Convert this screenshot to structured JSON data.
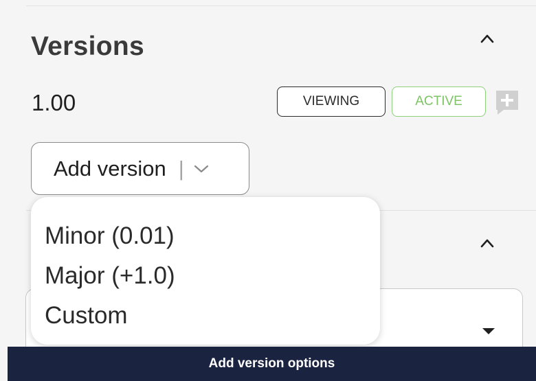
{
  "versions_section": {
    "title": "Versions",
    "collapse_icon": "chevron-up-icon",
    "current_version": "1.00",
    "badges": {
      "viewing": "VIEWING",
      "active": "ACTIVE"
    },
    "add_comment_icon": "comment-plus-icon",
    "add_version_button": {
      "label": "Add version",
      "separator": "|",
      "icon": "chevron-down-icon"
    }
  },
  "dropdown_menu": {
    "items": [
      {
        "label": "Minor (0.01)"
      },
      {
        "label": "Major (+1.0)"
      },
      {
        "label": "Custom"
      }
    ]
  },
  "second_section": {
    "collapse_icon": "chevron-up-icon",
    "select_caret_icon": "caret-down-icon"
  },
  "tooltip": {
    "text": "Add version options"
  },
  "colors": {
    "panel_background": "#f5f5f5",
    "active_green": "#7cc464",
    "tooltip_background": "#1a2340",
    "comment_icon_gray": "#d0d0d0"
  }
}
